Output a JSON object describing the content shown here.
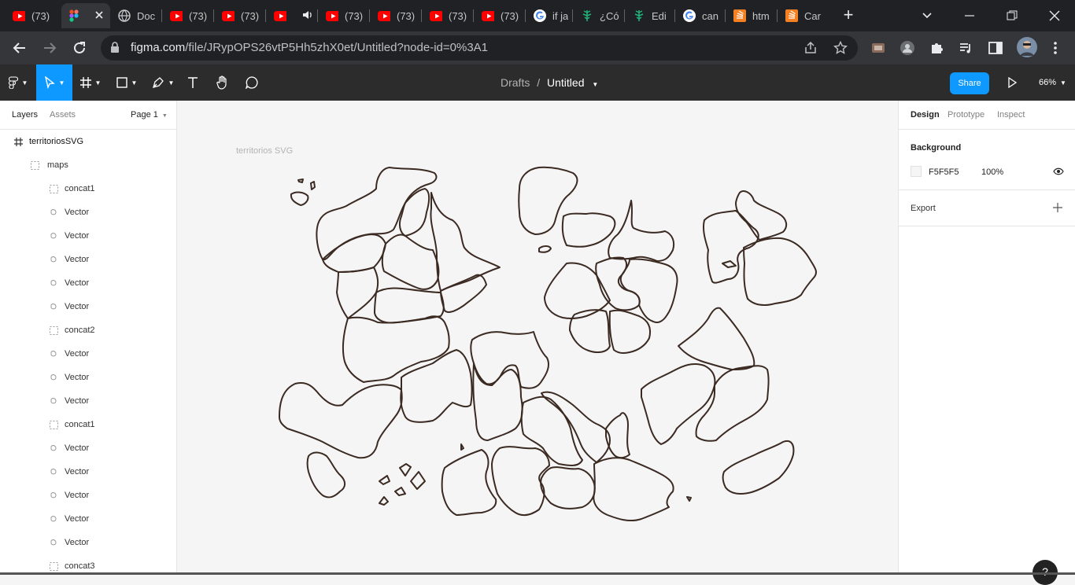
{
  "browser": {
    "tabs": [
      {
        "title": "(73)",
        "icon": "youtube-icon"
      },
      {
        "title": "",
        "icon": "figma-icon",
        "active": true
      },
      {
        "title": "Doc",
        "icon": "globe-icon"
      },
      {
        "title": "(73)",
        "icon": "youtube-icon"
      },
      {
        "title": "(73)",
        "icon": "youtube-icon"
      },
      {
        "title": "",
        "icon": "youtube-icon",
        "audio": true
      },
      {
        "title": "(73)",
        "icon": "youtube-icon"
      },
      {
        "title": "(73)",
        "icon": "youtube-icon"
      },
      {
        "title": "(73)",
        "icon": "youtube-icon"
      },
      {
        "title": "(73)",
        "icon": "youtube-icon"
      },
      {
        "title": "if ja",
        "icon": "google-icon"
      },
      {
        "title": "¿Có",
        "icon": "tree-icon"
      },
      {
        "title": "Edi",
        "icon": "tree-icon"
      },
      {
        "title": "can",
        "icon": "google-icon"
      },
      {
        "title": "htm",
        "icon": "stackoverflow-icon"
      },
      {
        "title": "Car",
        "icon": "stackoverflow-icon"
      }
    ],
    "url_host": "figma.com",
    "url_path": "/file/JRypOPS26vtP5Hh5zhX0et/Untitled?node-id=0%3A1",
    "accent": "#0d99ff"
  },
  "toolbar": {
    "breadcrumb_parent": "Drafts",
    "breadcrumb_sep": "/",
    "file_name": "Untitled",
    "share_label": "Share",
    "zoom": "66%"
  },
  "left_panel": {
    "tabs": [
      "Layers",
      "Assets"
    ],
    "page": "Page 1",
    "layers": [
      {
        "name": "territoriosSVG",
        "icon": "frame-icon",
        "depth": 0
      },
      {
        "name": "maps",
        "icon": "group-icon",
        "depth": 1
      },
      {
        "name": "concat1",
        "icon": "group-icon",
        "depth": 2
      },
      {
        "name": "Vector",
        "icon": "vector-icon",
        "depth": 2
      },
      {
        "name": "Vector",
        "icon": "vector-icon",
        "depth": 2
      },
      {
        "name": "Vector",
        "icon": "vector-icon",
        "depth": 2
      },
      {
        "name": "Vector",
        "icon": "vector-icon",
        "depth": 2
      },
      {
        "name": "Vector",
        "icon": "vector-icon",
        "depth": 2
      },
      {
        "name": "concat2",
        "icon": "group-icon",
        "depth": 2
      },
      {
        "name": "Vector",
        "icon": "vector-icon",
        "depth": 2
      },
      {
        "name": "Vector",
        "icon": "vector-icon",
        "depth": 2
      },
      {
        "name": "Vector",
        "icon": "vector-icon",
        "depth": 2
      },
      {
        "name": "concat1",
        "icon": "group-icon",
        "depth": 2
      },
      {
        "name": "Vector",
        "icon": "vector-icon",
        "depth": 2
      },
      {
        "name": "Vector",
        "icon": "vector-icon",
        "depth": 2
      },
      {
        "name": "Vector",
        "icon": "vector-icon",
        "depth": 2
      },
      {
        "name": "Vector",
        "icon": "vector-icon",
        "depth": 2
      },
      {
        "name": "Vector",
        "icon": "vector-icon",
        "depth": 2
      },
      {
        "name": "concat3",
        "icon": "group-icon",
        "depth": 2
      }
    ]
  },
  "canvas": {
    "frame_label": "territorios SVG",
    "stroke_color": "#3b2a22"
  },
  "right_panel": {
    "tabs": [
      "Design",
      "Prototype",
      "Inspect"
    ],
    "background_title": "Background",
    "background_hex": "F5F5F5",
    "background_opacity": "100%",
    "export_title": "Export"
  },
  "help_label": "?"
}
